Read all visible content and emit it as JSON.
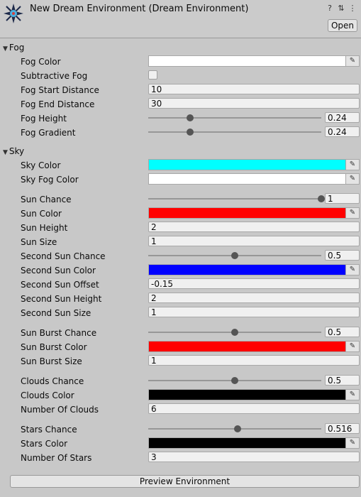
{
  "header": {
    "title": "New Dream Environment (Dream Environment)",
    "open_label": "Open",
    "icons": [
      "help-icon",
      "preset-icon",
      "more-icon"
    ]
  },
  "fog": {
    "title": "Fog",
    "fog_color": {
      "label": "Fog Color",
      "color": "#ffffff"
    },
    "subtractive_fog": {
      "label": "Subtractive Fog",
      "checked": false
    },
    "fog_start_distance": {
      "label": "Fog Start Distance",
      "value": "10"
    },
    "fog_end_distance": {
      "label": "Fog End Distance",
      "value": "30"
    },
    "fog_height": {
      "label": "Fog Height",
      "value": "0.24",
      "fraction": 0.24
    },
    "fog_gradient": {
      "label": "Fog Gradient",
      "value": "0.24",
      "fraction": 0.24
    }
  },
  "sky": {
    "title": "Sky",
    "sky_color": {
      "label": "Sky Color",
      "color": "#00ffff"
    },
    "sky_fog_color": {
      "label": "Sky Fog Color",
      "color": "#ffffff"
    },
    "sun_chance": {
      "label": "Sun Chance",
      "value": "1",
      "fraction": 1
    },
    "sun_color": {
      "label": "Sun Color",
      "color": "#ff0000"
    },
    "sun_height": {
      "label": "Sun Height",
      "value": "2"
    },
    "sun_size": {
      "label": "Sun Size",
      "value": "1"
    },
    "second_sun_chance": {
      "label": "Second Sun Chance",
      "value": "0.5",
      "fraction": 0.5
    },
    "second_sun_color": {
      "label": "Second Sun Color",
      "color": "#0000ff"
    },
    "second_sun_offset": {
      "label": "Second Sun Offset",
      "value": "-0.15"
    },
    "second_sun_height": {
      "label": "Second Sun Height",
      "value": "2"
    },
    "second_sun_size": {
      "label": "Second Sun Size",
      "value": "1"
    },
    "sun_burst_chance": {
      "label": "Sun Burst Chance",
      "value": "0.5",
      "fraction": 0.5
    },
    "sun_burst_color": {
      "label": "Sun Burst Color",
      "color": "#ff0000"
    },
    "sun_burst_size": {
      "label": "Sun Burst Size",
      "value": "1"
    },
    "clouds_chance": {
      "label": "Clouds Chance",
      "value": "0.5",
      "fraction": 0.5
    },
    "clouds_color": {
      "label": "Clouds Color",
      "color": "#000000"
    },
    "number_of_clouds": {
      "label": "Number Of Clouds",
      "value": "6"
    },
    "stars_chance": {
      "label": "Stars Chance",
      "value": "0.516",
      "fraction": 0.516
    },
    "stars_color": {
      "label": "Stars Color",
      "color": "#000000"
    },
    "number_of_stars": {
      "label": "Number Of Stars",
      "value": "3"
    }
  },
  "footer": {
    "preview_label": "Preview Environment"
  }
}
